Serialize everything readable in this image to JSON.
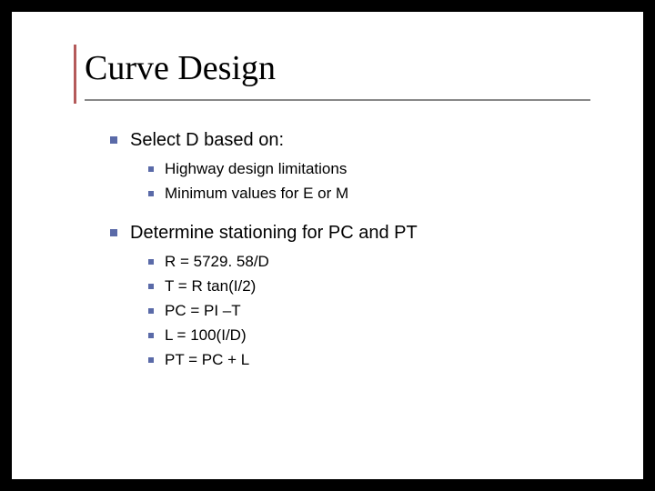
{
  "slide": {
    "title": "Curve Design",
    "items": [
      {
        "text": "Select D based on:",
        "sub": [
          "Highway design limitations",
          "Minimum values for E or M"
        ]
      },
      {
        "text": "Determine stationing for PC and PT",
        "sub": [
          "R = 5729. 58/D",
          "T = R tan(I/2)",
          "PC = PI –T",
          "L = 100(I/D)",
          "PT = PC + L"
        ]
      }
    ]
  }
}
